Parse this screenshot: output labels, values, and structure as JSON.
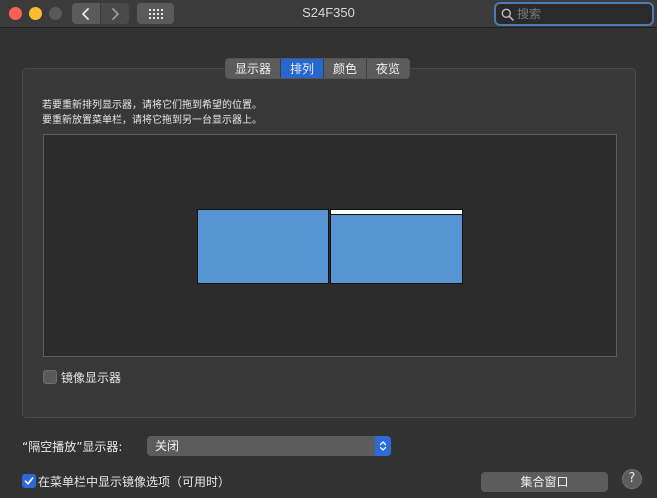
{
  "window": {
    "title": "S24F350",
    "traffic_colors": {
      "close": "#fe5f57",
      "minimize": "#febc2e",
      "zoom": "#5a5a5a"
    }
  },
  "toolbar": {
    "back_icon": "chevron-left-icon",
    "forward_icon": "chevron-right-icon",
    "grid_icon": "grid-icon"
  },
  "search": {
    "placeholder": "搜索",
    "icon": "search-icon"
  },
  "tabs": [
    {
      "label": "显示器",
      "active": false
    },
    {
      "label": "排列",
      "active": true
    },
    {
      "label": "颜色",
      "active": false
    },
    {
      "label": "夜览",
      "active": false
    }
  ],
  "arrangement": {
    "instruction_line1": "若要重新排列显示器，请将它们拖到希望的位置。",
    "instruction_line2": "要重新放置菜单栏，请将它拖到另一台显示器上。",
    "display_color": "#5794d2",
    "displays": [
      {
        "id": "left",
        "has_menubar": false
      },
      {
        "id": "right",
        "has_menubar": true
      }
    ]
  },
  "mirror": {
    "label": "镜像显示器",
    "checked": false
  },
  "airplay": {
    "label": "“隔空播放”显示器:",
    "value": "关闭"
  },
  "show_mirror_in_menubar": {
    "label": "在菜单栏中显示镜像选项（可用时）",
    "checked": true
  },
  "gather_button": {
    "label": "集合窗口"
  },
  "help_button": {
    "label": "?"
  },
  "accent_color": "#2866d2"
}
